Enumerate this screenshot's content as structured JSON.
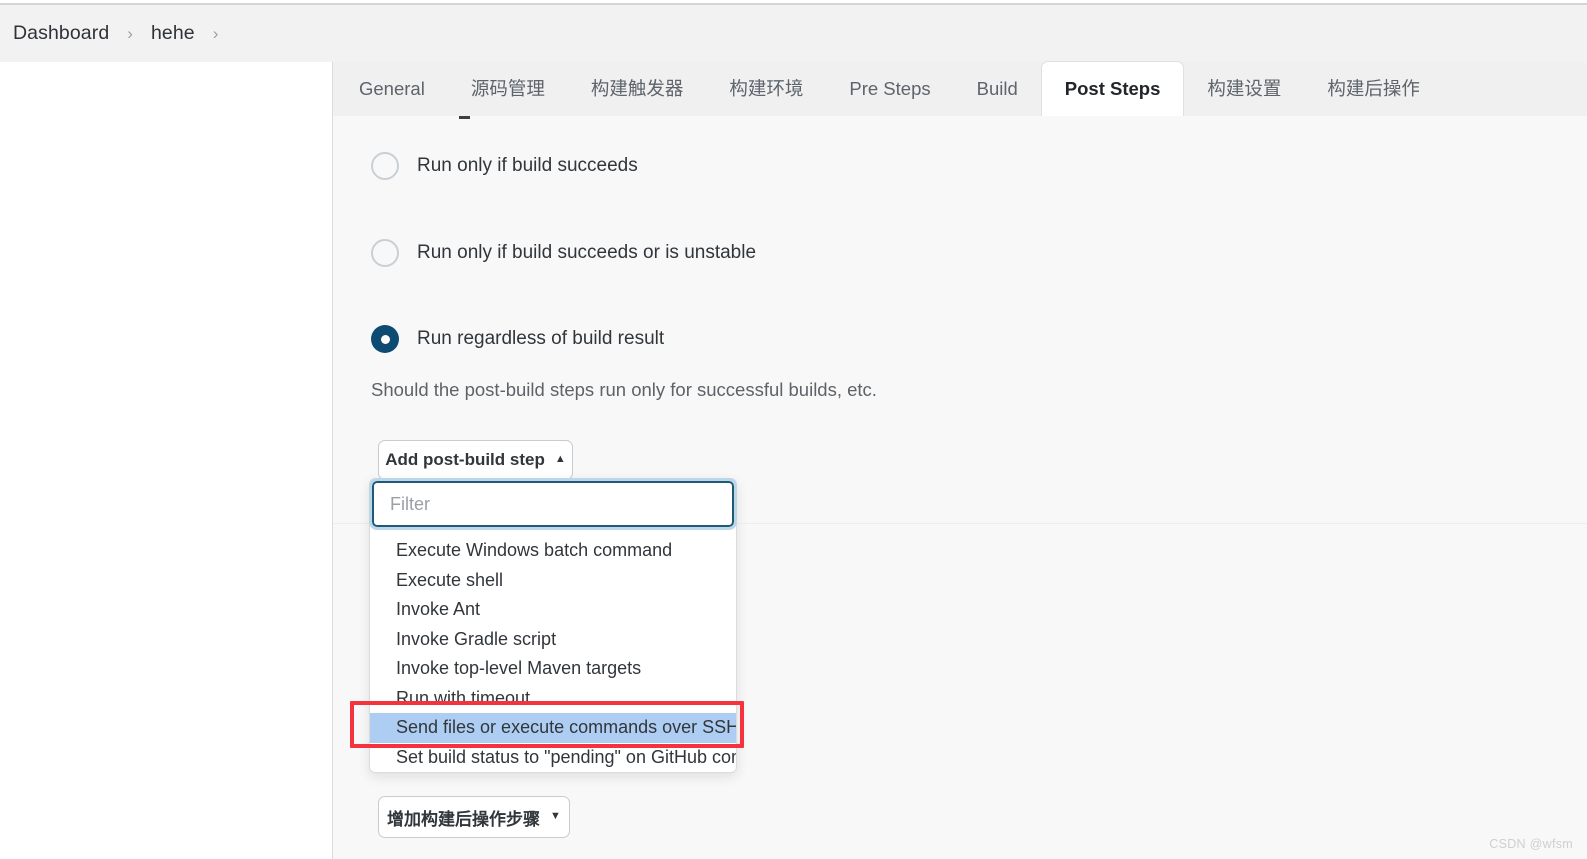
{
  "breadcrumb": {
    "items": [
      {
        "label": "Dashboard"
      },
      {
        "label": "hehe"
      }
    ],
    "separator": "›"
  },
  "tabs": [
    {
      "label": "General",
      "active": false
    },
    {
      "label": "源码管理",
      "active": false
    },
    {
      "label": "构建触发器",
      "active": false
    },
    {
      "label": "构建环境",
      "active": false
    },
    {
      "label": "Pre Steps",
      "active": false
    },
    {
      "label": "Build",
      "active": false
    },
    {
      "label": "Post Steps",
      "active": true
    },
    {
      "label": "构建设置",
      "active": false
    },
    {
      "label": "构建后操作",
      "active": false
    }
  ],
  "run_condition": {
    "options": [
      {
        "label": "Run only if build succeeds",
        "selected": false
      },
      {
        "label": "Run only if build succeeds or is unstable",
        "selected": false
      },
      {
        "label": "Run regardless of build result",
        "selected": true
      }
    ],
    "help_text": "Should the post-build steps run only for successful builds, etc."
  },
  "buttons": {
    "add_post_build_step": "Add post-build step",
    "add_post_build_step_caret": "▲",
    "add_post_build_action": "增加构建后操作步骤",
    "add_post_build_action_caret": "▼"
  },
  "dropdown": {
    "filter_placeholder": "Filter",
    "filter_value": "",
    "items": [
      {
        "label": "Execute Windows batch command",
        "highlighted": false
      },
      {
        "label": "Execute shell",
        "highlighted": false
      },
      {
        "label": "Invoke Ant",
        "highlighted": false
      },
      {
        "label": "Invoke Gradle script",
        "highlighted": false
      },
      {
        "label": "Invoke top-level Maven targets",
        "highlighted": false
      },
      {
        "label": "Run with timeout",
        "highlighted": false
      },
      {
        "label": "Send files or execute commands over SSH",
        "highlighted": true
      },
      {
        "label": "Set build status to \"pending\" on GitHub commit",
        "highlighted": false
      }
    ]
  },
  "annotation": {
    "color": "#f5333f",
    "target_label": "Send files or execute commands over SSH"
  },
  "watermark": {
    "text": "CSDN @wfsm"
  },
  "colors": {
    "accent": "#0d4b73",
    "highlight": "#aecdf2",
    "annotation": "#f5333f",
    "tabbar_bg": "#f0f0f0",
    "content_bg": "#f8f8f8",
    "breadcrumb_bg": "#f2f2f2"
  }
}
